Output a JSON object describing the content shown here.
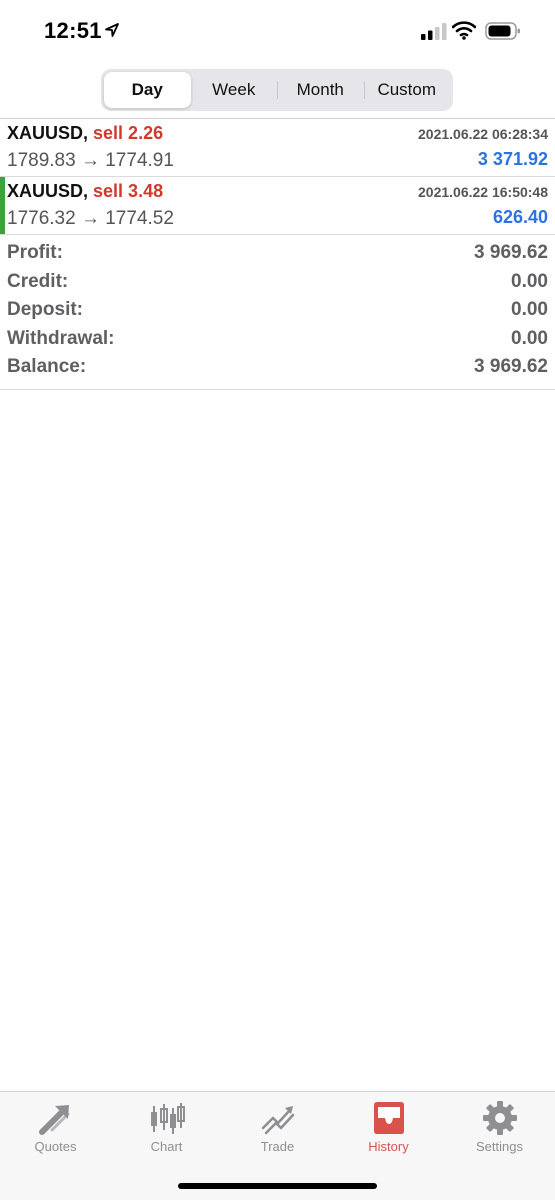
{
  "status_bar": {
    "time": "12:51",
    "icons": [
      "location-arrow-icon",
      "cellular-signal-icon",
      "wifi-icon",
      "battery-icon"
    ]
  },
  "period_tabs": {
    "items": [
      {
        "label": "Day",
        "active": true
      },
      {
        "label": "Week",
        "active": false
      },
      {
        "label": "Month",
        "active": false
      },
      {
        "label": "Custom",
        "active": false
      }
    ]
  },
  "deals": [
    {
      "symbol": "XAUUSD,",
      "type": "sell 2.26",
      "datetime": "2021.06.22 06:28:34",
      "prices": "1789.83 → 1774.91",
      "profit": "3 371.92",
      "selected": false
    },
    {
      "symbol": "XAUUSD,",
      "type": "sell 3.48",
      "datetime": "2021.06.22 16:50:48",
      "prices": "1776.32 → 1774.52",
      "profit": "626.40",
      "selected": true
    }
  ],
  "summary": [
    {
      "label": "Profit:",
      "value": "3 969.62"
    },
    {
      "label": "Credit:",
      "value": "0.00"
    },
    {
      "label": "Deposit:",
      "value": "0.00"
    },
    {
      "label": "Withdrawal:",
      "value": "0.00"
    },
    {
      "label": "Balance:",
      "value": "3 969.62"
    }
  ],
  "tab_bar": {
    "items": [
      {
        "label": "Quotes",
        "icon": "quotes-arrows-icon",
        "active": false
      },
      {
        "label": "Chart",
        "icon": "candlestick-chart-icon",
        "active": false
      },
      {
        "label": "Trade",
        "icon": "trade-trend-icon",
        "active": false
      },
      {
        "label": "History",
        "icon": "inbox-tray-icon",
        "active": true
      },
      {
        "label": "Settings",
        "icon": "gear-icon",
        "active": false
      }
    ]
  },
  "colors": {
    "sell": "#d2392b",
    "profit": "#2c72e0",
    "selected_marker": "#3aa33a",
    "active_tab": "#d9534a",
    "inactive_tab": "#8e8e93"
  }
}
